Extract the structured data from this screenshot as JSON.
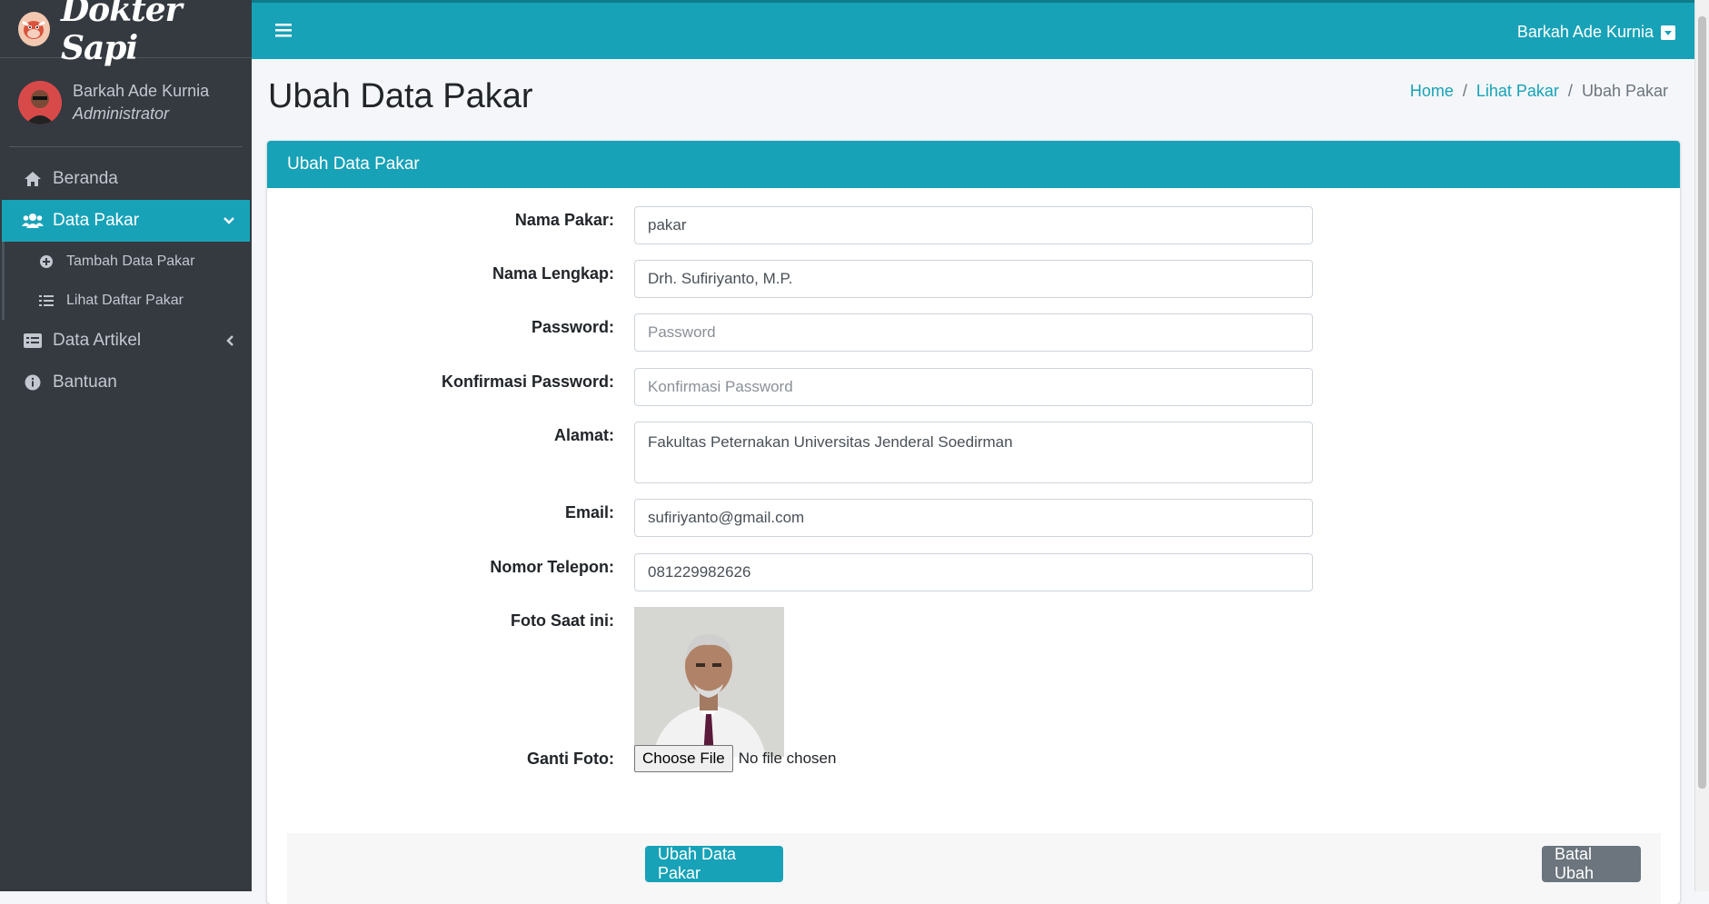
{
  "brand": {
    "name": "Dokter Sapi"
  },
  "user": {
    "name": "Barkah Ade Kurnia",
    "role": "Administrator"
  },
  "sidebar": {
    "items": [
      {
        "label": "Beranda",
        "icon": "home-icon"
      },
      {
        "label": "Data Pakar",
        "icon": "users-icon",
        "active": true
      },
      {
        "label": "Data Artikel",
        "icon": "list-alt-icon"
      },
      {
        "label": "Bantuan",
        "icon": "info-circle-icon"
      }
    ],
    "subitems": [
      {
        "label": "Tambah Data Pakar",
        "icon": "plus-circle-icon"
      },
      {
        "label": "Lihat Daftar Pakar",
        "icon": "list-icon"
      }
    ]
  },
  "topbar": {
    "user_name": "Barkah Ade Kurnia"
  },
  "page": {
    "title": "Ubah Data Pakar",
    "breadcrumb": [
      "Home",
      "Lihat Pakar",
      "Ubah Pakar"
    ]
  },
  "card": {
    "title": "Ubah Data Pakar"
  },
  "form": {
    "nama_pakar": {
      "label": "Nama Pakar:",
      "value": "pakar"
    },
    "nama_lengkap": {
      "label": "Nama Lengkap:",
      "value": "Drh. Sufiriyanto, M.P."
    },
    "password": {
      "label": "Password:",
      "placeholder": "Password"
    },
    "konfirmasi": {
      "label": "Konfirmasi Password:",
      "placeholder": "Konfirmasi Password"
    },
    "alamat": {
      "label": "Alamat:",
      "value": "Fakultas Peternakan Universitas Jenderal Soedirman"
    },
    "email": {
      "label": "Email:",
      "value": "sufiriyanto@gmail.com"
    },
    "telepon": {
      "label": "Nomor Telepon:",
      "value": "081229982626"
    },
    "foto": {
      "label": "Foto Saat ini:"
    },
    "ganti_foto": {
      "label": "Ganti Foto:",
      "button": "Choose File",
      "status": "No file chosen"
    }
  },
  "buttons": {
    "submit": "Ubah Data Pakar",
    "cancel": "Batal Ubah"
  },
  "colors": {
    "primary": "#17a2b8",
    "sidebar": "#343a40",
    "secondary": "#6c757d"
  }
}
